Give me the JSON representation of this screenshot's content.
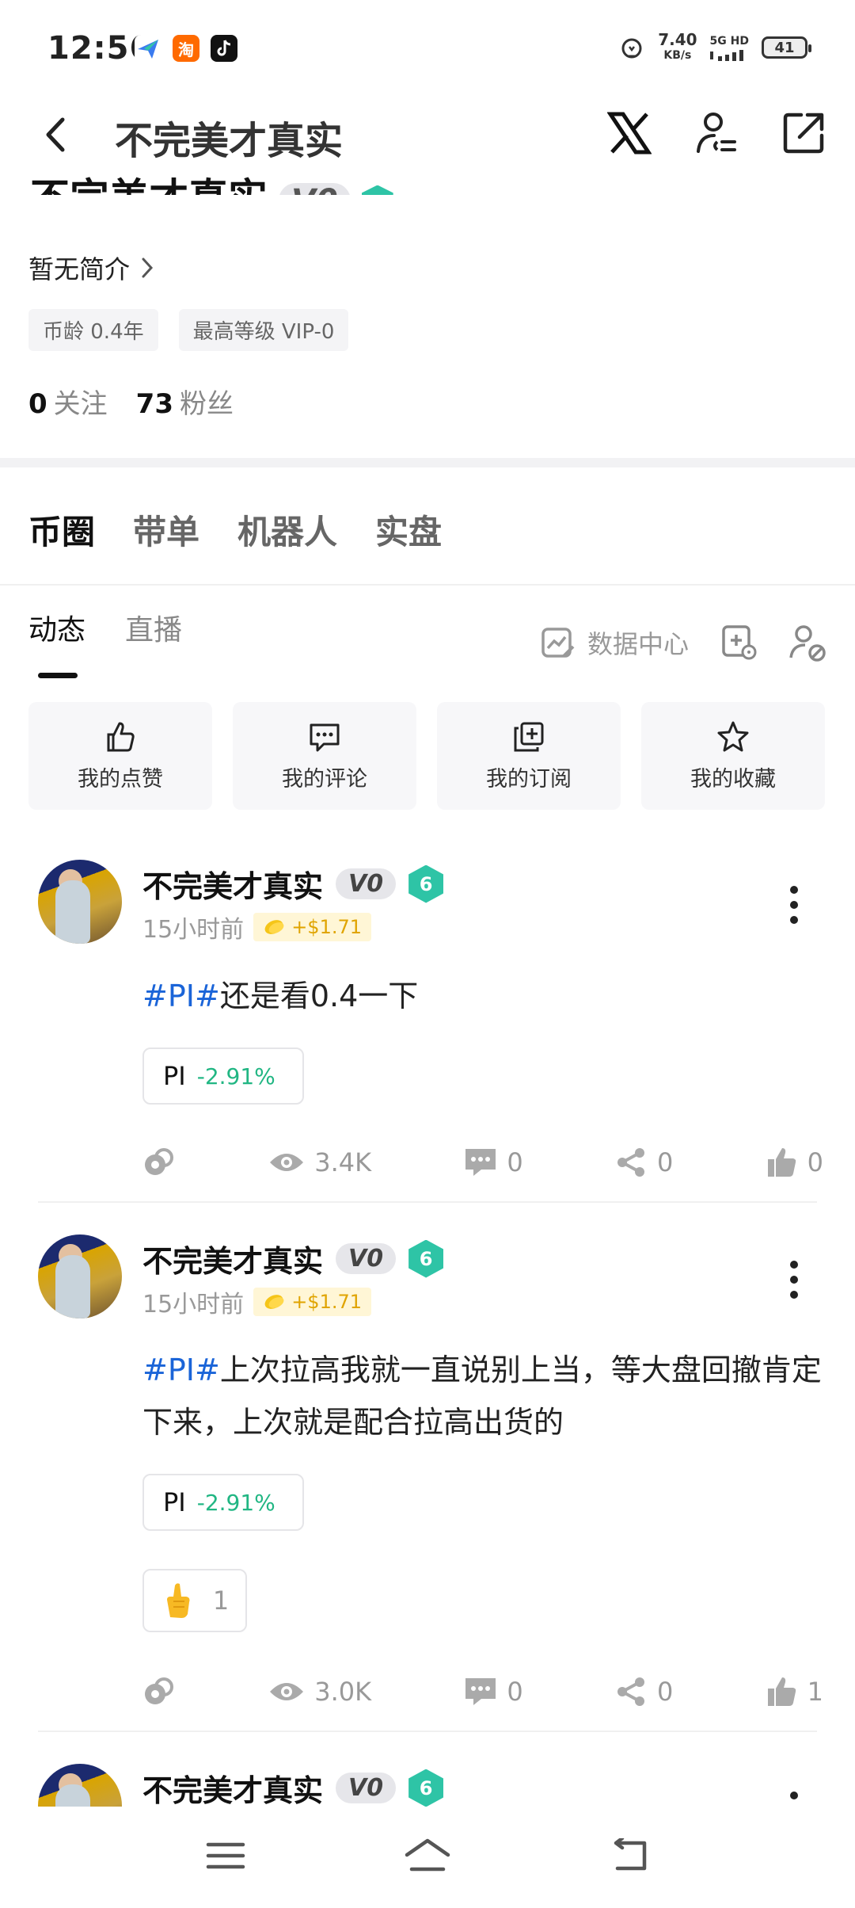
{
  "status_bar": {
    "time": "12:56",
    "app_icons": [
      "feishu-icon",
      "taobao-icon",
      "douyin-icon"
    ],
    "taobao_label": "淘",
    "speed_value": "7.40",
    "speed_unit": "KB/s",
    "network_top": "5G HD",
    "battery": "41"
  },
  "header": {
    "title": "不完美才真实"
  },
  "profile": {
    "name": "不完美才真实",
    "vip_badge": "V0",
    "bio": "暂无简介",
    "tags": [
      "币龄 0.4年",
      "最高等级 VIP-0"
    ],
    "following_count": "0",
    "following_label": "关注",
    "followers_count": "73",
    "followers_label": "粉丝"
  },
  "main_tabs": [
    "币圈",
    "带单",
    "机器人",
    "实盘"
  ],
  "sub_tabs": [
    "动态",
    "直播"
  ],
  "data_center_label": "数据中心",
  "quick_actions": [
    {
      "label": "我的点赞",
      "icon": "thumbs-up-icon"
    },
    {
      "label": "我的评论",
      "icon": "comment-icon"
    },
    {
      "label": "我的订阅",
      "icon": "subscribe-icon"
    },
    {
      "label": "我的收藏",
      "icon": "star-icon"
    }
  ],
  "posts": [
    {
      "author": "不完美才真实",
      "badge": "V0",
      "level": "6",
      "time": "15小时前",
      "reward": "+$1.71",
      "topic": "#PI#",
      "text": "还是看0.4一下",
      "coin": "PI",
      "coin_change": "-2.91%",
      "views": "3.4K",
      "comments": "0",
      "shares": "0",
      "likes": "0"
    },
    {
      "author": "不完美才真实",
      "badge": "V0",
      "level": "6",
      "time": "15小时前",
      "reward": "+$1.71",
      "topic": "#PI#",
      "text": "上次拉高我就一直说别上当，等大盘回撤肯定下来，上次就是配合拉高出货的",
      "coin": "PI",
      "coin_change": "-2.91%",
      "reaction_count": "1",
      "views": "3.0K",
      "comments": "0",
      "shares": "0",
      "likes": "1"
    },
    {
      "author": "不完美才真实",
      "badge": "V0",
      "level": "6"
    }
  ],
  "colors": {
    "topic_blue": "#1a64d8",
    "change_green": "#21b683",
    "level_teal": "#2ec4a6",
    "reward_gold": "#e0a400"
  }
}
